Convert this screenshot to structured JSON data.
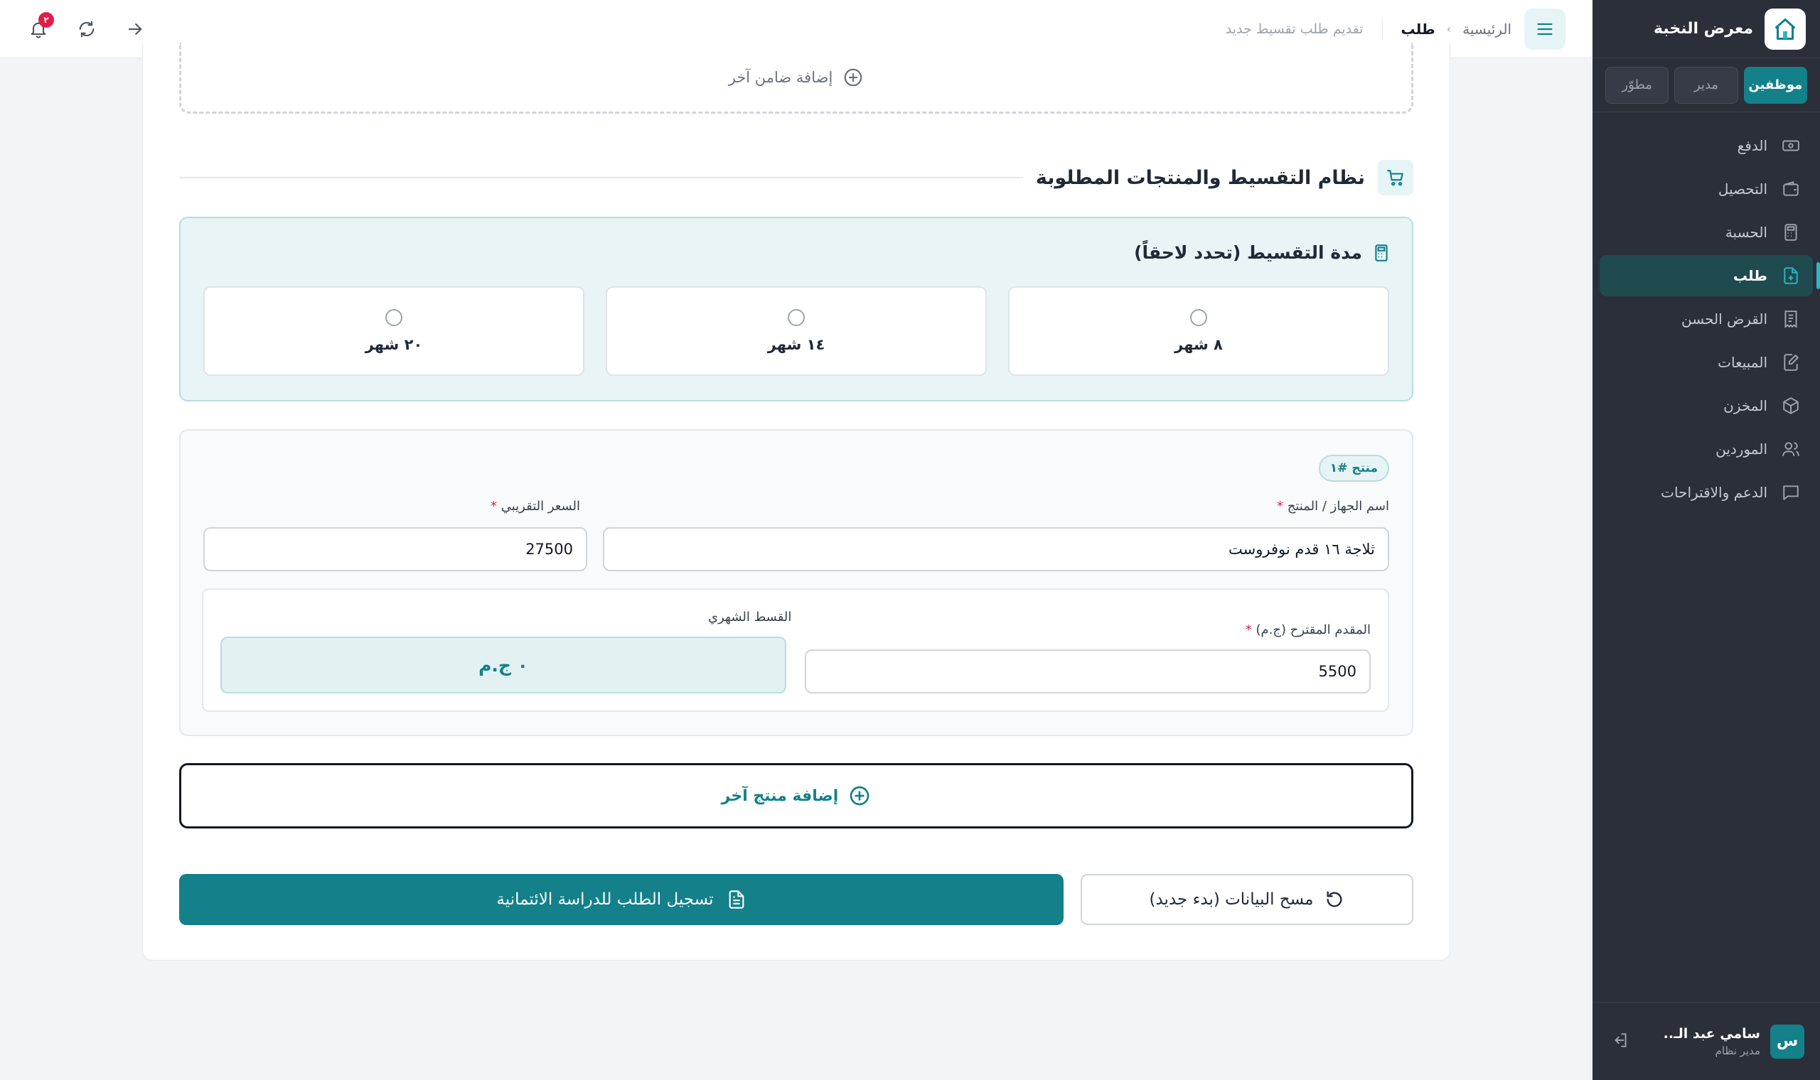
{
  "app": {
    "name": "معرض النخبة"
  },
  "roles": [
    "موظفين",
    "مدير",
    "مطوّر"
  ],
  "nav": [
    {
      "label": "الدفع",
      "icon": "cash-icon"
    },
    {
      "label": "التحصيل",
      "icon": "wallet-icon"
    },
    {
      "label": "الحسبة",
      "icon": "calculator-icon"
    },
    {
      "label": "طلب",
      "icon": "file-plus-icon"
    },
    {
      "label": "القرض الحسن",
      "icon": "receipt-icon"
    },
    {
      "label": "المبيعات",
      "icon": "edit-icon"
    },
    {
      "label": "المخزن",
      "icon": "box-icon"
    },
    {
      "label": "الموردين",
      "icon": "users-icon"
    },
    {
      "label": "الدعم والاقتراحات",
      "icon": "message-icon"
    }
  ],
  "user": {
    "initial": "س",
    "name": "سامي عبد الـ..",
    "role": "مدير نظام"
  },
  "breadcrumb": {
    "home": "الرئيسية",
    "sep": "›",
    "current": "طلب",
    "subtitle": "تقديم طلب تقسيط جديد"
  },
  "notifications": {
    "count": "٢"
  },
  "guarantor": {
    "add_label": "إضافة ضامن آخر"
  },
  "section": {
    "title": "نظام التقسيط والمنتجات المطلوبة"
  },
  "plan": {
    "title": "مدة التقسيط (تحدد لاحقاً)",
    "options": [
      "٨ شهر",
      "١٤ شهر",
      "٢٠ شهر"
    ]
  },
  "product": {
    "badge": "منتج #١",
    "name_label": "اسم الجهاز / المنتج",
    "name_value": "ثلاجة ١٦ قدم نوفروست",
    "price_label": "السعر التقريبي",
    "price_value": "27500",
    "down_label": "المقدم المقترح (ج.م)",
    "down_value": "5500",
    "monthly_label": "القسط الشهري",
    "monthly_value": "٠ ج.م"
  },
  "actions": {
    "add_product": "إضافة منتج آخر",
    "submit": "تسجيل الطلب للدراسة الائتمانية",
    "clear": "مسح البيانات (بدء جديد)"
  },
  "colors": {
    "accent": "#13808a",
    "sidebar": "#2b2f3a",
    "danger": "#e11d48"
  }
}
